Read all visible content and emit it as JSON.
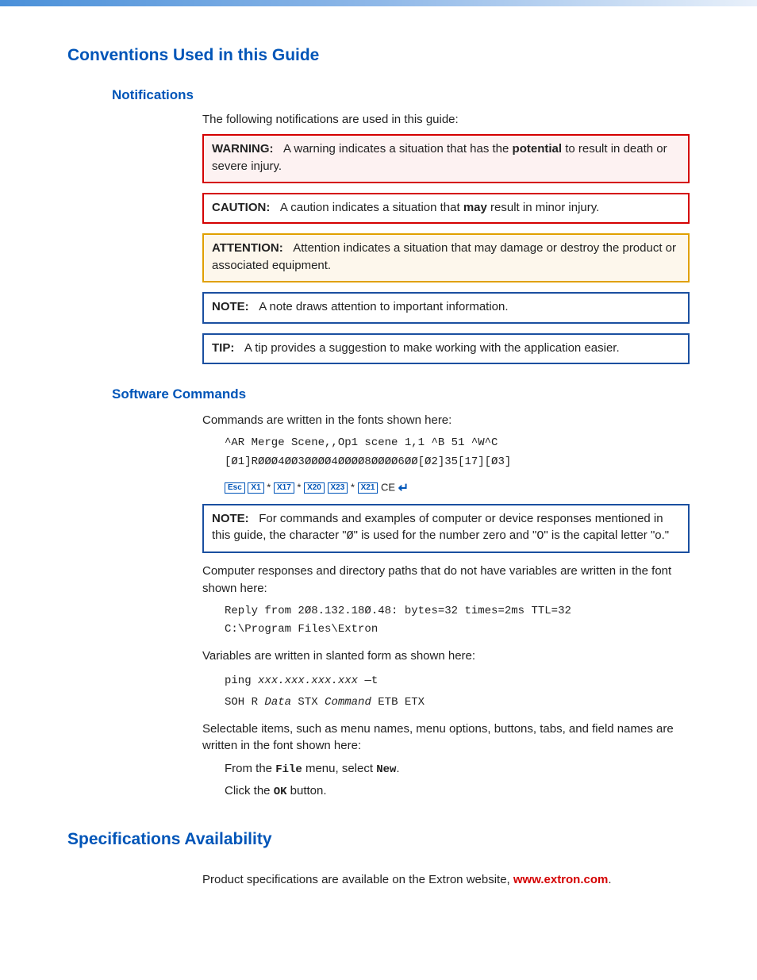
{
  "h1_conventions": "Conventions Used in this Guide",
  "h2_notifications": "Notifications",
  "notif_intro": "The following notifications are used in this guide:",
  "warning_label": "WARNING:",
  "warning_text1": "A warning indicates a situation that has the ",
  "warning_bold": "potential",
  "warning_text2": " to result in death or severe injury.",
  "caution_label": "CAUTION:",
  "caution_text1": "A caution indicates a situation that ",
  "caution_bold": "may",
  "caution_text2": " result in minor injury.",
  "attention_label": "ATTENTION:",
  "attention_text": "Attention indicates a situation that may damage or destroy the product or associated equipment.",
  "note_label": "NOTE:",
  "note_text": "A note draws attention to important information.",
  "tip_label": "TIP:",
  "tip_text": "A tip provides a suggestion to make working with the application easier.",
  "h2_software": "Software Commands",
  "sw_intro": "Commands are written in the fonts shown here:",
  "cmd_line1": "^AR Merge Scene,,Op1 scene 1,1 ^B 51 ^W^C",
  "cmd_line2": "[Ø1]RØØØ4ØØ3ØØØØ4ØØØØ8ØØØØ6ØØ[Ø2]35[17][Ø3]",
  "esc": "Esc",
  "x1": "X1",
  "x17": "X17",
  "x20": "X20",
  "x23": "X23",
  "x21": "X21",
  "star": "*",
  "ce": "CE",
  "note2_label": "NOTE:",
  "note2_text1": "For commands and examples of computer or device responses mentioned in this guide, the character \"",
  "note2_zero": "Ø",
  "note2_text2": "\" is used for the number zero and \"",
  "note2_o": "O",
  "note2_text3": "\" is the capital letter \"o.\"",
  "resp_intro": "Computer responses and directory paths that do not have variables are written in the font shown here:",
  "resp_line1": "Reply from 2Ø8.132.18Ø.48: bytes=32 times=2ms TTL=32",
  "resp_line2": "C:\\Program Files\\Extron",
  "var_intro": "Variables are written in slanted form as shown here:",
  "var_ping": "ping ",
  "var_ping_var": "xxx.xxx.xxx.xxx",
  "var_ping_t": " —t",
  "var_soh1": "SOH R ",
  "var_data": "Data",
  "var_stx": " STX ",
  "var_cmd": "Command",
  "var_etb": " ETB ETX",
  "sel_intro": "Selectable items, such as menu names, menu options, buttons, tabs, and field names are written in the font shown here:",
  "from_the": "From the ",
  "file": "File",
  "menu_select": " menu, select ",
  "new": "New",
  "period": ".",
  "click_the": "Click the ",
  "ok": "OK",
  "button_period": " button.",
  "h1_specs": "Specifications Availability",
  "specs_text": "Product specifications are available on the Extron website, ",
  "specs_link": "www.extron.com",
  "specs_period": "."
}
